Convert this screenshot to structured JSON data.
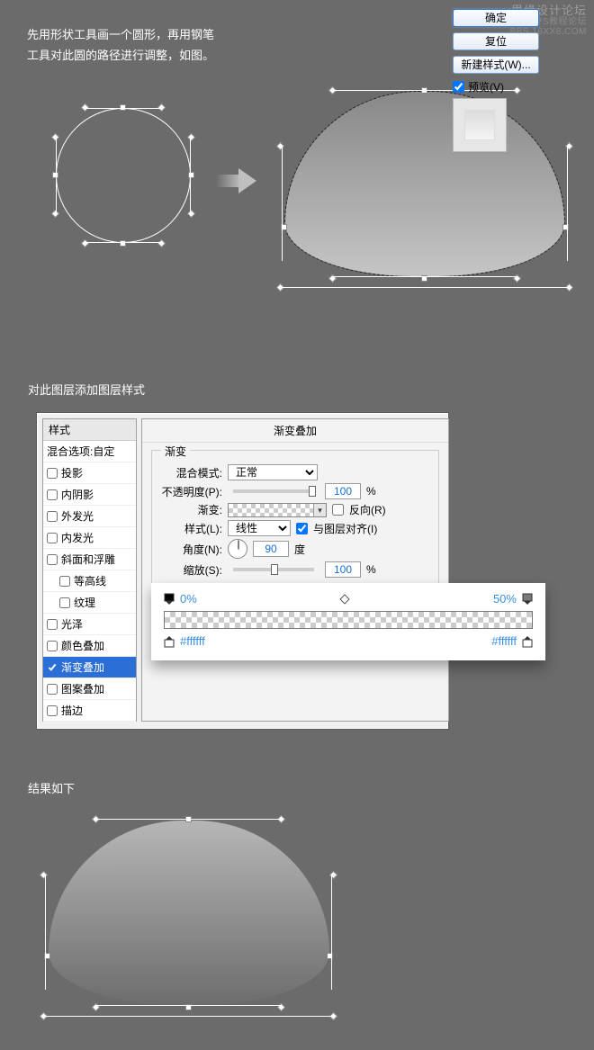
{
  "watermark": {
    "line1": "思缘设计论坛",
    "line2": "PS教程论坛",
    "line3": "BBS.16XX8.COM"
  },
  "intro": {
    "line1": "先用形状工具画一个圆形，再用钢笔",
    "line2": "工具对此圆的路径进行调整，如图。"
  },
  "section2": "对此图层添加图层样式",
  "dialog": {
    "styles_header": "样式",
    "blend_header": "混合选项:自定",
    "items": [
      {
        "label": "投影",
        "checked": false,
        "indent": false
      },
      {
        "label": "内阴影",
        "checked": false,
        "indent": false
      },
      {
        "label": "外发光",
        "checked": false,
        "indent": false
      },
      {
        "label": "内发光",
        "checked": false,
        "indent": false
      },
      {
        "label": "斜面和浮雕",
        "checked": false,
        "indent": false
      },
      {
        "label": "等高线",
        "checked": false,
        "indent": true
      },
      {
        "label": "纹理",
        "checked": false,
        "indent": true
      },
      {
        "label": "光泽",
        "checked": false,
        "indent": false
      },
      {
        "label": "颜色叠加",
        "checked": false,
        "indent": false
      },
      {
        "label": "渐变叠加",
        "checked": true,
        "indent": false,
        "selected": true
      },
      {
        "label": "图案叠加",
        "checked": false,
        "indent": false
      },
      {
        "label": "描边",
        "checked": false,
        "indent": false
      }
    ],
    "panel_title": "渐变叠加",
    "group_title": "渐变",
    "blend_mode_label": "混合模式:",
    "blend_mode_value": "正常",
    "opacity_label": "不透明度(P):",
    "opacity_value": "100",
    "pct": "%",
    "gradient_label": "渐变:",
    "reverse_label": "反向(R)",
    "style_label": "样式(L):",
    "style_value": "线性",
    "align_label": "与图层对齐(I)",
    "angle_label": "角度(N):",
    "angle_value": "90",
    "degree": "度",
    "scale_label": "缩放(S):",
    "scale_value": "100"
  },
  "buttons": {
    "ok": "确定",
    "reset": "复位",
    "newstyle": "新建样式(W)...",
    "preview": "预览(V)"
  },
  "gradient": {
    "left_opacity": "0%",
    "right_opacity": "50%",
    "left_color": "#ffffff",
    "right_color": "#ffffff"
  },
  "section3": "结果如下"
}
